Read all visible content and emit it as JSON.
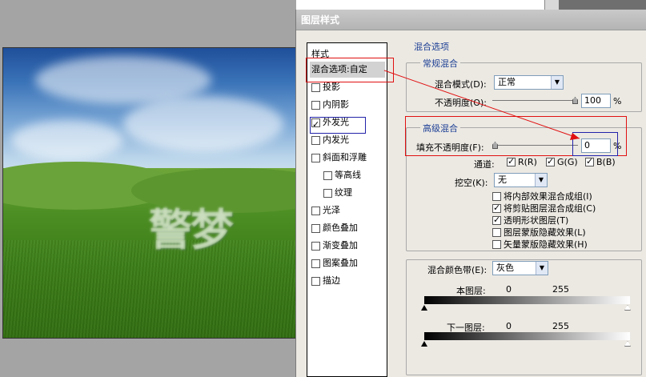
{
  "canvas": {
    "overlay_text": "警梦"
  },
  "dialog": {
    "title": "图层样式",
    "styles_header": "样式",
    "style_items": [
      {
        "label": "混合选项:自定",
        "checkbox": false,
        "selected": true
      },
      {
        "label": "投影",
        "checkbox": true,
        "checked": false
      },
      {
        "label": "内阴影",
        "checkbox": true,
        "checked": false
      },
      {
        "label": "外发光",
        "checkbox": true,
        "checked": true
      },
      {
        "label": "内发光",
        "checkbox": true,
        "checked": false
      },
      {
        "label": "斜面和浮雕",
        "checkbox": true,
        "checked": false
      },
      {
        "label": "等高线",
        "checkbox": true,
        "checked": false,
        "sub": true
      },
      {
        "label": "纹理",
        "checkbox": true,
        "checked": false,
        "sub": true
      },
      {
        "label": "光泽",
        "checkbox": true,
        "checked": false
      },
      {
        "label": "颜色叠加",
        "checkbox": true,
        "checked": false
      },
      {
        "label": "渐变叠加",
        "checkbox": true,
        "checked": false
      },
      {
        "label": "图案叠加",
        "checkbox": true,
        "checked": false
      },
      {
        "label": "描边",
        "checkbox": true,
        "checked": false
      }
    ],
    "blend_options_title": "混合选项",
    "general": {
      "title": "常规混合",
      "mode_label": "混合模式(D):",
      "mode_value": "正常",
      "opacity_label": "不透明度(O):",
      "opacity_value": "100",
      "opacity_unit": "%",
      "opacity_level": 1.0
    },
    "advanced": {
      "title": "高级混合",
      "fill_label": "填充不透明度(F):",
      "fill_value": "0",
      "fill_unit": "%",
      "fill_level": 0.0,
      "channels_label": "通道:",
      "channels": [
        {
          "label": "R(R)",
          "checked": true
        },
        {
          "label": "G(G)",
          "checked": true
        },
        {
          "label": "B(B)",
          "checked": true
        }
      ],
      "knockout_label": "挖空(K):",
      "knockout_value": "无",
      "options": [
        {
          "label": "将内部效果混合成组(I)",
          "checked": false
        },
        {
          "label": "将剪贴图层混合成组(C)",
          "checked": true
        },
        {
          "label": "透明形状图层(T)",
          "checked": true
        },
        {
          "label": "图层蒙版隐藏效果(L)",
          "checked": false
        },
        {
          "label": "矢量蒙版隐藏效果(H)",
          "checked": false
        }
      ]
    },
    "blend_if": {
      "label": "混合颜色带(E):",
      "value": "灰色",
      "this_layer_label": "本图层:",
      "this_layer_min": "0",
      "this_layer_max": "255",
      "underlying_label": "下一图层:",
      "underlying_min": "0",
      "underlying_max": "255"
    }
  },
  "colors": {
    "annotation_red": "#e01010",
    "annotation_blue": "#2222aa",
    "section_title": "#1c3f94"
  }
}
